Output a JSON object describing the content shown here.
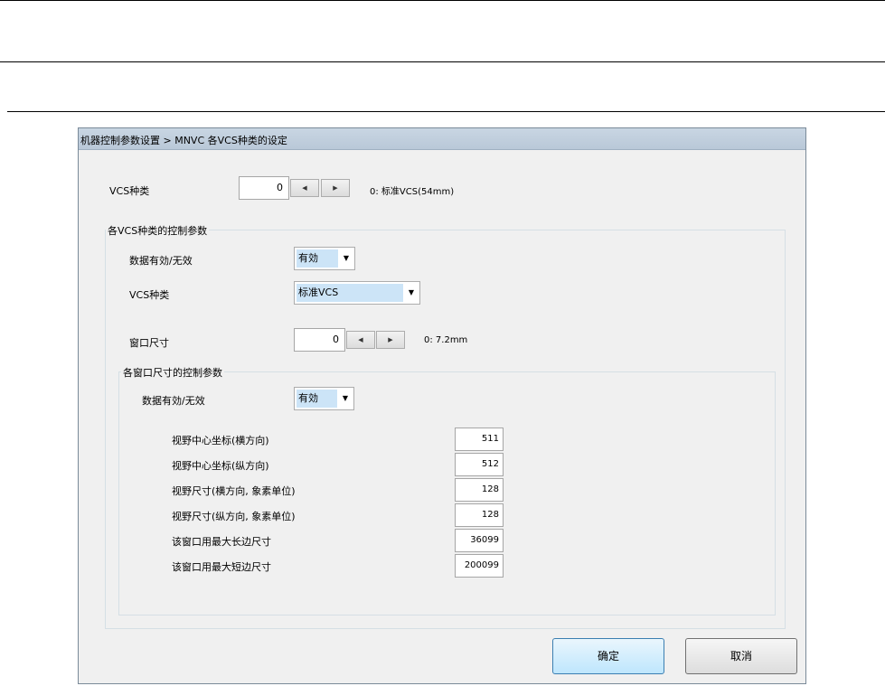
{
  "window": {
    "title": "机器控制参数设置 > MNVC 各VCS种类的设定"
  },
  "vcs_type": {
    "label": "VCS种类",
    "value": "0",
    "note": "0: 标准VCS(54mm)"
  },
  "group_vcs": {
    "title": "各VCS种类的控制参数",
    "data_valid": {
      "label": "数据有効/无效",
      "value": "有効"
    },
    "vcs_kind": {
      "label": "VCS种类",
      "value": "标准VCS"
    },
    "window_size": {
      "label": "窗口尺寸",
      "value": "0",
      "note": "0:  7.2mm"
    }
  },
  "group_window": {
    "title": "各窗口尺寸的控制参数",
    "data_valid": {
      "label": "数据有効/无效",
      "value": "有効"
    },
    "fields": [
      {
        "label": "视野中心坐标(横方向)",
        "value": "511"
      },
      {
        "label": "视野中心坐标(纵方向)",
        "value": "512"
      },
      {
        "label": "视野尺寸(横方向, 象素单位)",
        "value": "128"
      },
      {
        "label": "视野尺寸(纵方向, 象素单位)",
        "value": "128"
      },
      {
        "label": "该窗口用最大长边尺寸",
        "value": "36099"
      },
      {
        "label": "该窗口用最大短边尺寸",
        "value": "200099"
      }
    ]
  },
  "buttons": {
    "ok": "确定",
    "cancel": "取消"
  },
  "icons": {
    "spin_left": "◀",
    "spin_right": "▶",
    "dropdown": "▼"
  }
}
